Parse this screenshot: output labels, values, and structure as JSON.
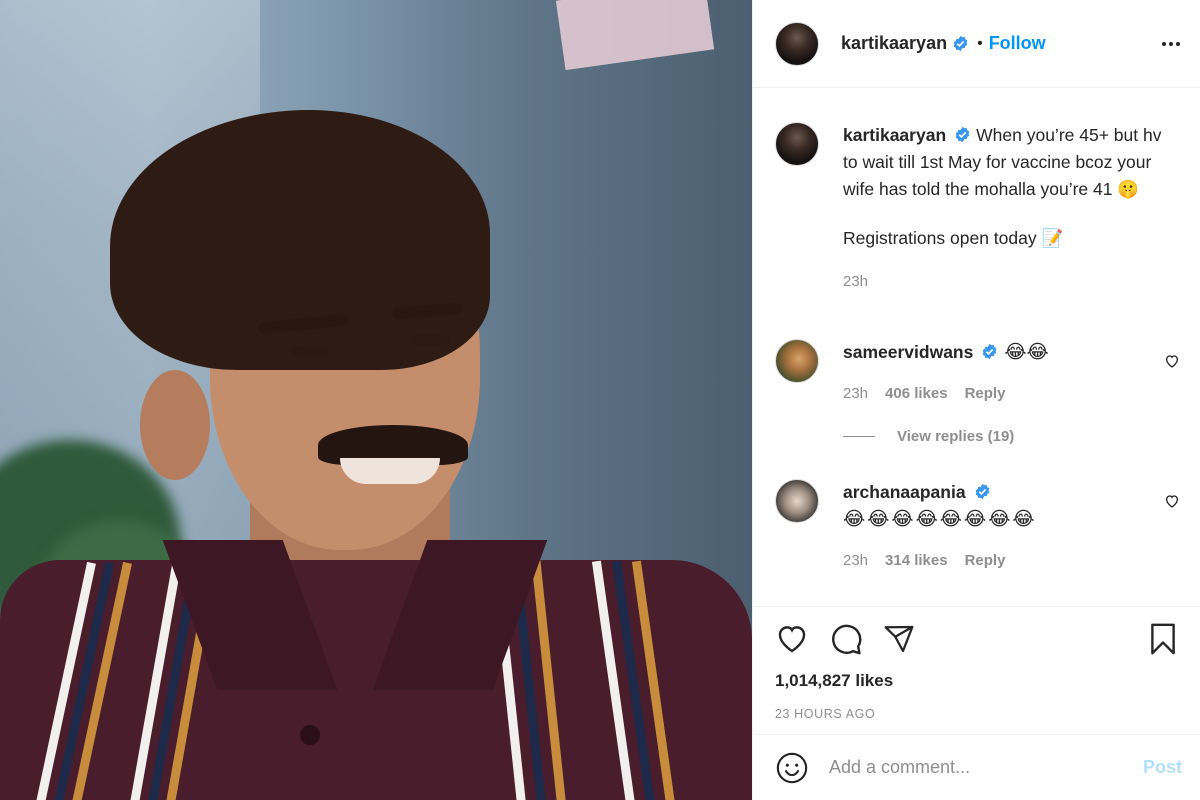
{
  "post": {
    "username": "kartikaaryan",
    "verified": true,
    "follow_label": "Follow",
    "separator": "•"
  },
  "caption": {
    "username": "kartikaaryan",
    "text": "When you’re 45+ but hv to wait till 1st May for vaccine bcoz your wife has told the mohalla you’re 41 🤫",
    "text_line2": "Registrations open today 📝",
    "time": "23h"
  },
  "comments": [
    {
      "username": "sameervidwans",
      "text": "😂😂",
      "time": "23h",
      "likes": "406 likes",
      "reply_label": "Reply",
      "view_replies": "View replies (19)"
    },
    {
      "username": "archanaapania",
      "text": "😂😂😂😂😂😂😂😂",
      "time": "23h",
      "likes": "314 likes",
      "reply_label": "Reply"
    }
  ],
  "actions": {
    "like_count": "1,014,827 likes",
    "posted_ago": "23 HOURS AGO"
  },
  "add_comment": {
    "placeholder": "Add a comment...",
    "post_label": "Post"
  },
  "colors": {
    "link_blue": "#0095f6",
    "post_disabled": "#b2dffc",
    "muted": "#8e8e8e",
    "verified_blue": "#3897f0"
  },
  "icons": [
    "more-options-icon",
    "verified-icon",
    "heart-icon",
    "comment-icon",
    "share-icon",
    "bookmark-icon",
    "emoji-icon"
  ]
}
